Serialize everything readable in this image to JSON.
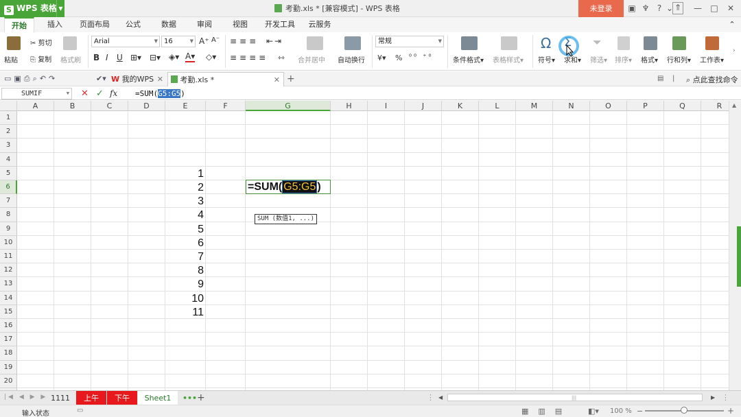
{
  "app": {
    "logo": "WPS 表格",
    "window_title": "考勤.xls * [兼容模式] - WPS 表格",
    "login_label": "未登录"
  },
  "menu_tabs": [
    "开始",
    "插入",
    "页面布局",
    "公式",
    "数据",
    "审阅",
    "视图",
    "开发工具",
    "云服务"
  ],
  "ribbon": {
    "paste": "粘贴",
    "cut": "剪切",
    "copy": "复制",
    "format_painter": "格式刷",
    "font_name": "Arial",
    "font_size": "16",
    "merge_center": "合并居中",
    "wrap_text": "自动换行",
    "number_format": "常规",
    "conditional_format": "条件格式",
    "table_style": "表格样式",
    "symbol": "符号",
    "sum": "求和",
    "filter": "筛选",
    "sort": "排序",
    "format": "格式",
    "row_col": "行和列",
    "worksheet": "工作表",
    "bold": "B",
    "italic": "I",
    "underline": "U",
    "percent": "%"
  },
  "doc_tabs": {
    "home": "我的WPS",
    "file": "考勤.xls *",
    "search": "点此查找命令"
  },
  "formula_bar": {
    "name_box": "SUMIF",
    "fx": "fx",
    "prefix": "=SUM(",
    "range": "G5:G5",
    "suffix": ")"
  },
  "columns": [
    "A",
    "B",
    "C",
    "D",
    "E",
    "F",
    "G",
    "H",
    "I",
    "J",
    "K",
    "L",
    "M",
    "N",
    "O",
    "P",
    "Q",
    "R"
  ],
  "rows": [
    "1",
    "2",
    "3",
    "4",
    "5",
    "6",
    "7",
    "8",
    "9",
    "10",
    "11",
    "12",
    "13",
    "14",
    "15",
    "16",
    "17",
    "18",
    "19",
    "20",
    "21"
  ],
  "column_e_values": [
    "1",
    "2",
    "3",
    "4",
    "5",
    "6",
    "7",
    "8",
    "9",
    "10",
    "11"
  ],
  "cell_editor": {
    "prefix": "=SUM(",
    "range": "G5:G5",
    "suffix": ")"
  },
  "tooltip": "SUM (数值1, ...)",
  "sheet_tabs": [
    {
      "label": "1111",
      "color": "#e9e9e9"
    },
    {
      "label": "上午",
      "color": "#e8191c"
    },
    {
      "label": "下午",
      "color": "#e8191c"
    },
    {
      "label": "Sheet1",
      "color": "#ffffff"
    }
  ],
  "status": {
    "mode": "输入状态",
    "zoom": "100 %"
  },
  "colors": {
    "accent": "#4aa538",
    "login": "#e8694b",
    "sheet_red": "#e8191c"
  }
}
